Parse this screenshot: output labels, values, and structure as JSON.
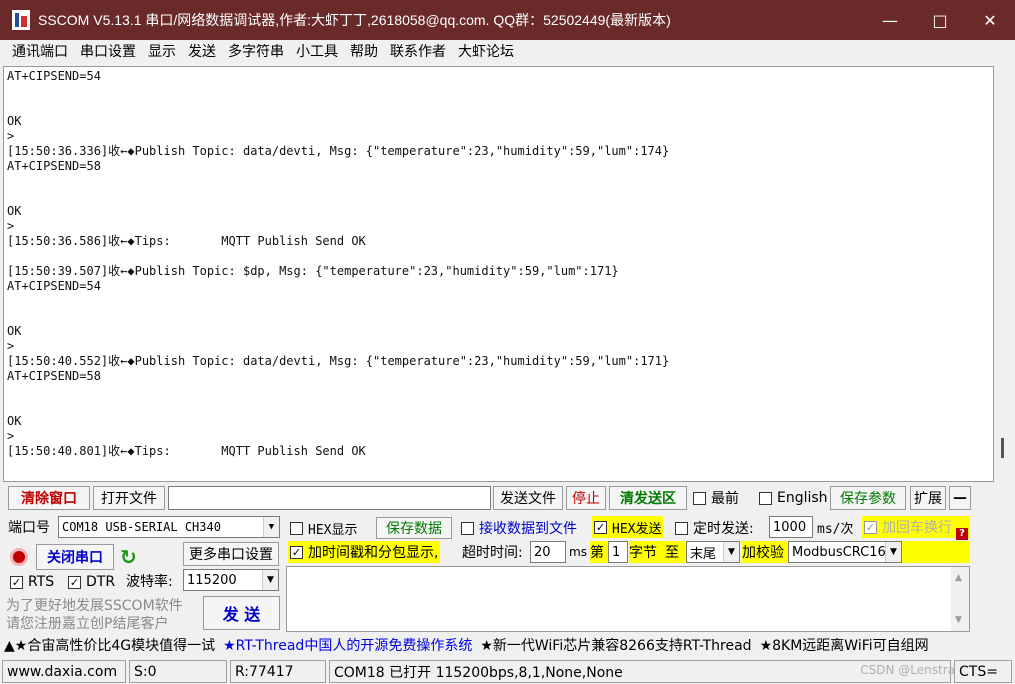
{
  "window": {
    "title": "SSCOM V5.13.1 串口/网络数据调试器,作者:大虾丁丁,2618058@qq.com. QQ群：52502449(最新版本)"
  },
  "menu": [
    "通讯端口",
    "串口设置",
    "显示",
    "发送",
    "多字符串",
    "小工具",
    "帮助",
    "联系作者",
    "大虾论坛"
  ],
  "terminal_lines": [
    "AT+CIPSEND=54",
    "",
    "",
    "OK",
    ">",
    "[15:50:36.336]收←◆Publish Topic: data/devti, Msg: {\"temperature\":23,\"humidity\":59,\"lum\":174}",
    "AT+CIPSEND=58",
    "",
    "",
    "OK",
    ">",
    "[15:50:36.586]收←◆Tips:       MQTT Publish Send OK",
    "",
    "[15:50:39.507]收←◆Publish Topic: $dp, Msg: {\"temperature\":23,\"humidity\":59,\"lum\":171}",
    "AT+CIPSEND=54",
    "",
    "",
    "OK",
    ">",
    "[15:50:40.552]收←◆Publish Topic: data/devti, Msg: {\"temperature\":23,\"humidity\":59,\"lum\":171}",
    "AT+CIPSEND=58",
    "",
    "",
    "OK",
    ">",
    "[15:50:40.801]收←◆Tips:       MQTT Publish Send OK",
    ""
  ],
  "toolbar": {
    "clear_window": "清除窗口",
    "open_file": "打开文件",
    "file_path": "",
    "send_file": "发送文件",
    "stop": "停止",
    "clear_send": "清发送区",
    "topmost": "最前",
    "english": "English",
    "save_params": "保存参数",
    "expand": "扩展",
    "collapse": "—"
  },
  "port": {
    "port_label": "端口号",
    "port_value": "COM18 USB-SERIAL CH340",
    "close_port": "关闭串口",
    "more_settings": "更多串口设置",
    "rts": "RTS",
    "dtr": "DTR",
    "baud_label": "波特率:",
    "baud_value": "115200",
    "promo_line1": "为了更好地发展SSCOM软件",
    "promo_line2": "请您注册嘉立创P结尾客户",
    "send": "发 送"
  },
  "options": {
    "hex_display": "HEX显示",
    "save_data": "保存数据",
    "recv_to_file": "接收数据到文件",
    "hex_send": "HEX发送",
    "timed_send": "定时发送:",
    "interval": "1000",
    "interval_unit": "ms/次",
    "add_crlf": "加回车换行",
    "add_timestamp": "加时间戳和分包显示,",
    "timeout_label": "超时时间:",
    "timeout_value": "20",
    "timeout_unit": "ms",
    "byte_from_label": "第",
    "byte_from_value": "1",
    "byte_unit": "字节",
    "to_label": "至",
    "to_value": "末尾",
    "checksum_label": "加校验",
    "checksum_value": "ModbusCRC16"
  },
  "news": {
    "item1": "▲★合宙高性价比4G模块值得一试",
    "item2": "★RT-Thread中国人的开源免费操作系统",
    "item3": "★新一代WiFi芯片兼容8266支持RT-Thread",
    "item4": "★8KM远距离WiFi可自组网"
  },
  "status": {
    "website": "www.daxia.com",
    "sent": "S:0",
    "received": "R:77417",
    "port_status": "COM18 已打开  115200bps,8,1,None,None",
    "cts": "CTS=",
    "watermark": "CSDN @Lenstra"
  }
}
